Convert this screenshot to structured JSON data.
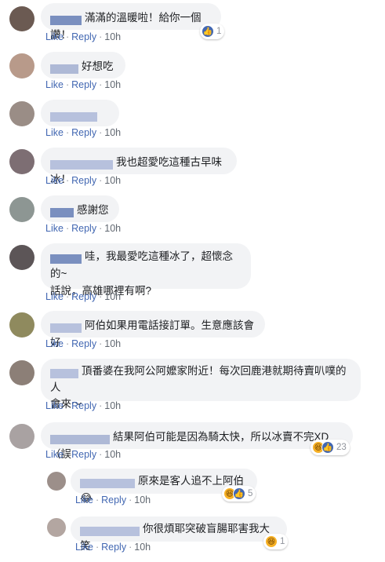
{
  "actions": {
    "like": "Like",
    "reply": "Reply",
    "sep": "·"
  },
  "comments": [
    {
      "text": "滿滿的溫暖啦！給你一個讚！",
      "time": "10h",
      "reactions": {
        "count": "1",
        "icons": [
          "like-icon"
        ]
      }
    },
    {
      "text": "好想吃",
      "time": "10h"
    },
    {
      "text": "",
      "time": "10h"
    },
    {
      "text": "我也超愛吃這種古早味冰！",
      "time": "10h"
    },
    {
      "text": "感謝您",
      "time": "10h"
    },
    {
      "text_line1": "哇，我最愛吃這種冰了，超懷念的~",
      "text_line2": "話說，高雄哪裡有啊?",
      "time": "10h"
    },
    {
      "text": "阿伯如果用電話接訂單。生意應該會好",
      "time": "10h"
    },
    {
      "text_line1": "頂番婆在我阿公阿嬤家附近！每次回鹿港就期待賣叭噗的人",
      "text_line2": "會來～",
      "time": "10h"
    },
    {
      "text": "結果阿伯可能是因為騎太快，所以冰賣不完XD（誤",
      "time": "10h",
      "reactions": {
        "count": "23",
        "icons": [
          "haha-icon",
          "like-icon"
        ]
      }
    }
  ],
  "replies": [
    {
      "text": "原來是客人追不上阿伯😂",
      "time": "10h",
      "reactions": {
        "count": "5",
        "icons": [
          "haha-icon",
          "like-icon"
        ]
      }
    },
    {
      "text": "你很煩耶突破盲腸耶害我大笑",
      "time": "10h",
      "reactions": {
        "count": "1",
        "icons": [
          "haha-icon"
        ]
      }
    }
  ],
  "colors": {
    "link": "#4267b2",
    "bubble": "#f2f3f5",
    "meta": "#606770",
    "like": "#4267b2",
    "haha": "#f7b125"
  },
  "icon_glyphs": {
    "like-icon": "👍",
    "haha-icon": "😆"
  }
}
